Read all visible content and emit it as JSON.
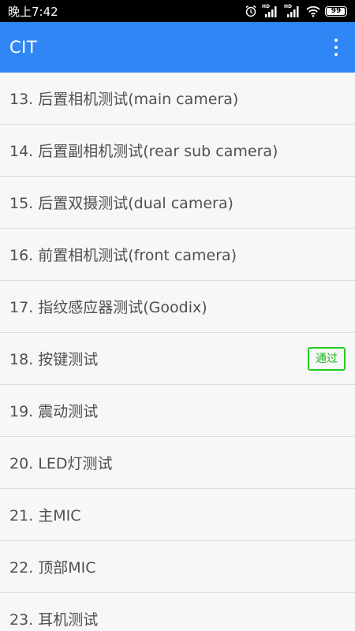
{
  "status_bar": {
    "time": "晚上7:42",
    "sim1_label": "HD",
    "sim2_label": "HD",
    "battery_level": "99"
  },
  "app_bar": {
    "title": "CIT",
    "menu_icon": "overflow-menu-icon"
  },
  "test_list": {
    "items": [
      {
        "label": "13. 后置相机测试(main camera)",
        "badge": ""
      },
      {
        "label": "14. 后置副相机测试(rear sub camera)",
        "badge": ""
      },
      {
        "label": "15. 后置双摄测试(dual camera)",
        "badge": ""
      },
      {
        "label": "16. 前置相机测试(front camera)",
        "badge": ""
      },
      {
        "label": "17. 指纹感应器测试(Goodix)",
        "badge": ""
      },
      {
        "label": "18. 按键测试",
        "badge": "通过"
      },
      {
        "label": "19. 震动测试",
        "badge": ""
      },
      {
        "label": "20. LED灯测试",
        "badge": ""
      },
      {
        "label": "21. 主MIC",
        "badge": ""
      },
      {
        "label": "22. 顶部MIC",
        "badge": ""
      },
      {
        "label": "23. 耳机测试",
        "badge": ""
      }
    ]
  },
  "colors": {
    "app_bar": "#2f86f4",
    "pass_badge": "#22cc22",
    "status_bar": "#000000"
  }
}
